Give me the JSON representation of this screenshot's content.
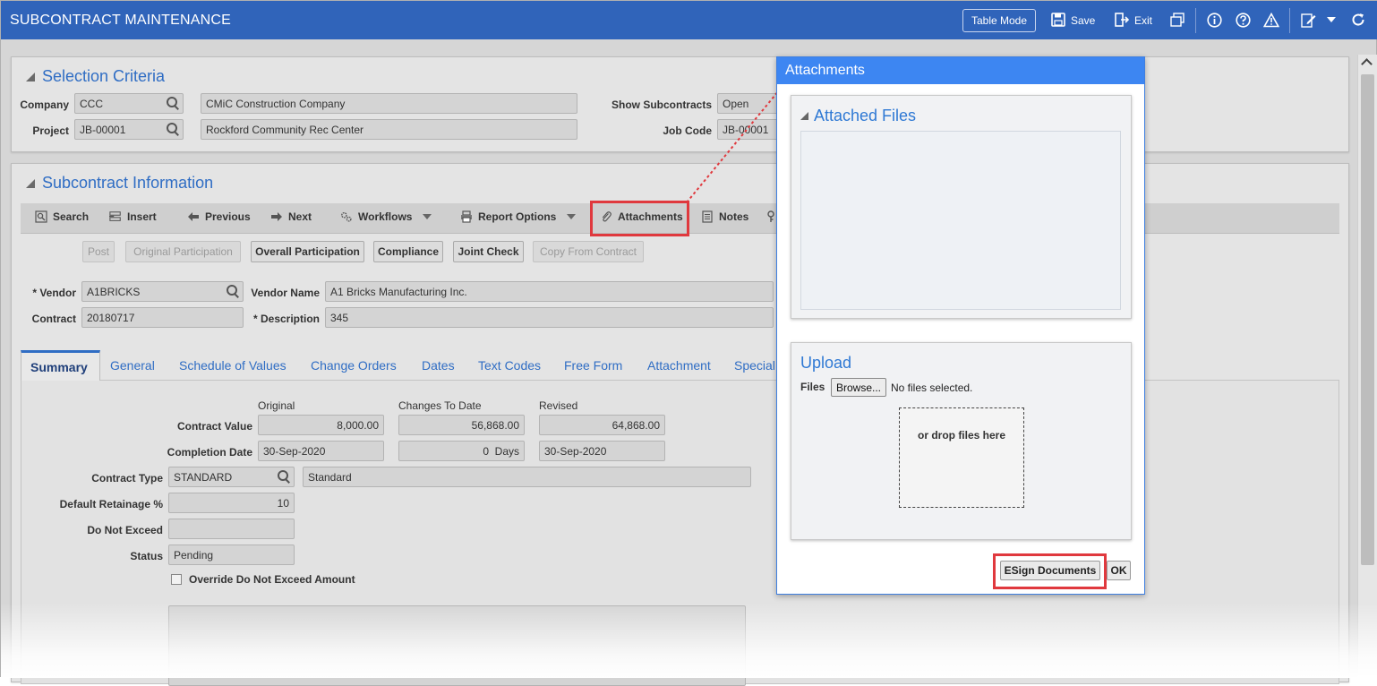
{
  "app": {
    "title": "SUBCONTRACT MAINTENANCE"
  },
  "header": {
    "table_mode": "Table Mode",
    "save": "Save",
    "exit": "Exit"
  },
  "selection": {
    "title": "Selection Criteria",
    "company_label": "Company",
    "company_code": "CCC",
    "company_name": "CMiC Construction Company",
    "project_label": "Project",
    "project_code": "JB-00001",
    "project_name": "Rockford Community Rec Center",
    "show_label": "Show Subcontracts",
    "show_value": "Open",
    "job_label": "Job Code",
    "job_value": "JB-00001"
  },
  "subcontract": {
    "title": "Subcontract Information",
    "toolbar": {
      "search": "Search",
      "insert": "Insert",
      "previous": "Previous",
      "next": "Next",
      "workflows": "Workflows",
      "report_options": "Report Options",
      "attachments": "Attachments",
      "notes": "Notes"
    },
    "buttons": {
      "post": "Post",
      "original_participation": "Original Participation",
      "overall_participation": "Overall Participation",
      "compliance": "Compliance",
      "joint_check": "Joint Check",
      "copy_from_contract": "Copy From Contract"
    },
    "vendor_label": "* Vendor",
    "vendor_value": "A1BRICKS",
    "vendor_name_label": "Vendor Name",
    "vendor_name_value": "A1 Bricks Manufacturing Inc.",
    "contract_label": "Contract",
    "contract_value": "20180717",
    "description_label": "* Description",
    "description_value": "345"
  },
  "tabs": [
    "Summary",
    "General",
    "Schedule of Values",
    "Change Orders",
    "Dates",
    "Text Codes",
    "Free Form",
    "Attachment",
    "Special"
  ],
  "summary": {
    "col_original": "Original",
    "col_changes": "Changes To Date",
    "col_revised": "Revised",
    "contract_value_label": "Contract Value",
    "contract_value_original": "8,000.00",
    "contract_value_changes": "56,868.00",
    "contract_value_revised": "64,868.00",
    "completion_label": "Completion Date",
    "completion_original": "30-Sep-2020",
    "completion_changes": "0  Days",
    "completion_revised": "30-Sep-2020",
    "contract_type_label": "Contract Type",
    "contract_type_code": "STANDARD",
    "contract_type_name": "Standard",
    "retainage_label": "Default Retainage %",
    "retainage_value": "10",
    "dne_label": "Do Not Exceed",
    "dne_value": "",
    "status_label": "Status",
    "status_value": "Pending",
    "override_label": "Override Do Not Exceed Amount"
  },
  "dialog": {
    "title": "Attachments",
    "attached_files_title": "Attached Files",
    "upload_title": "Upload",
    "files_label": "Files",
    "browse_label": "Browse...",
    "no_files": "No files selected.",
    "drop_text": "or drop files here",
    "esign_label": "ESign Documents",
    "ok_label": "OK"
  },
  "colors": {
    "header_bg": "#3064ba",
    "accent": "#2f6dc4",
    "dialog_header": "#3d86f2",
    "highlight": "#e0393e"
  }
}
